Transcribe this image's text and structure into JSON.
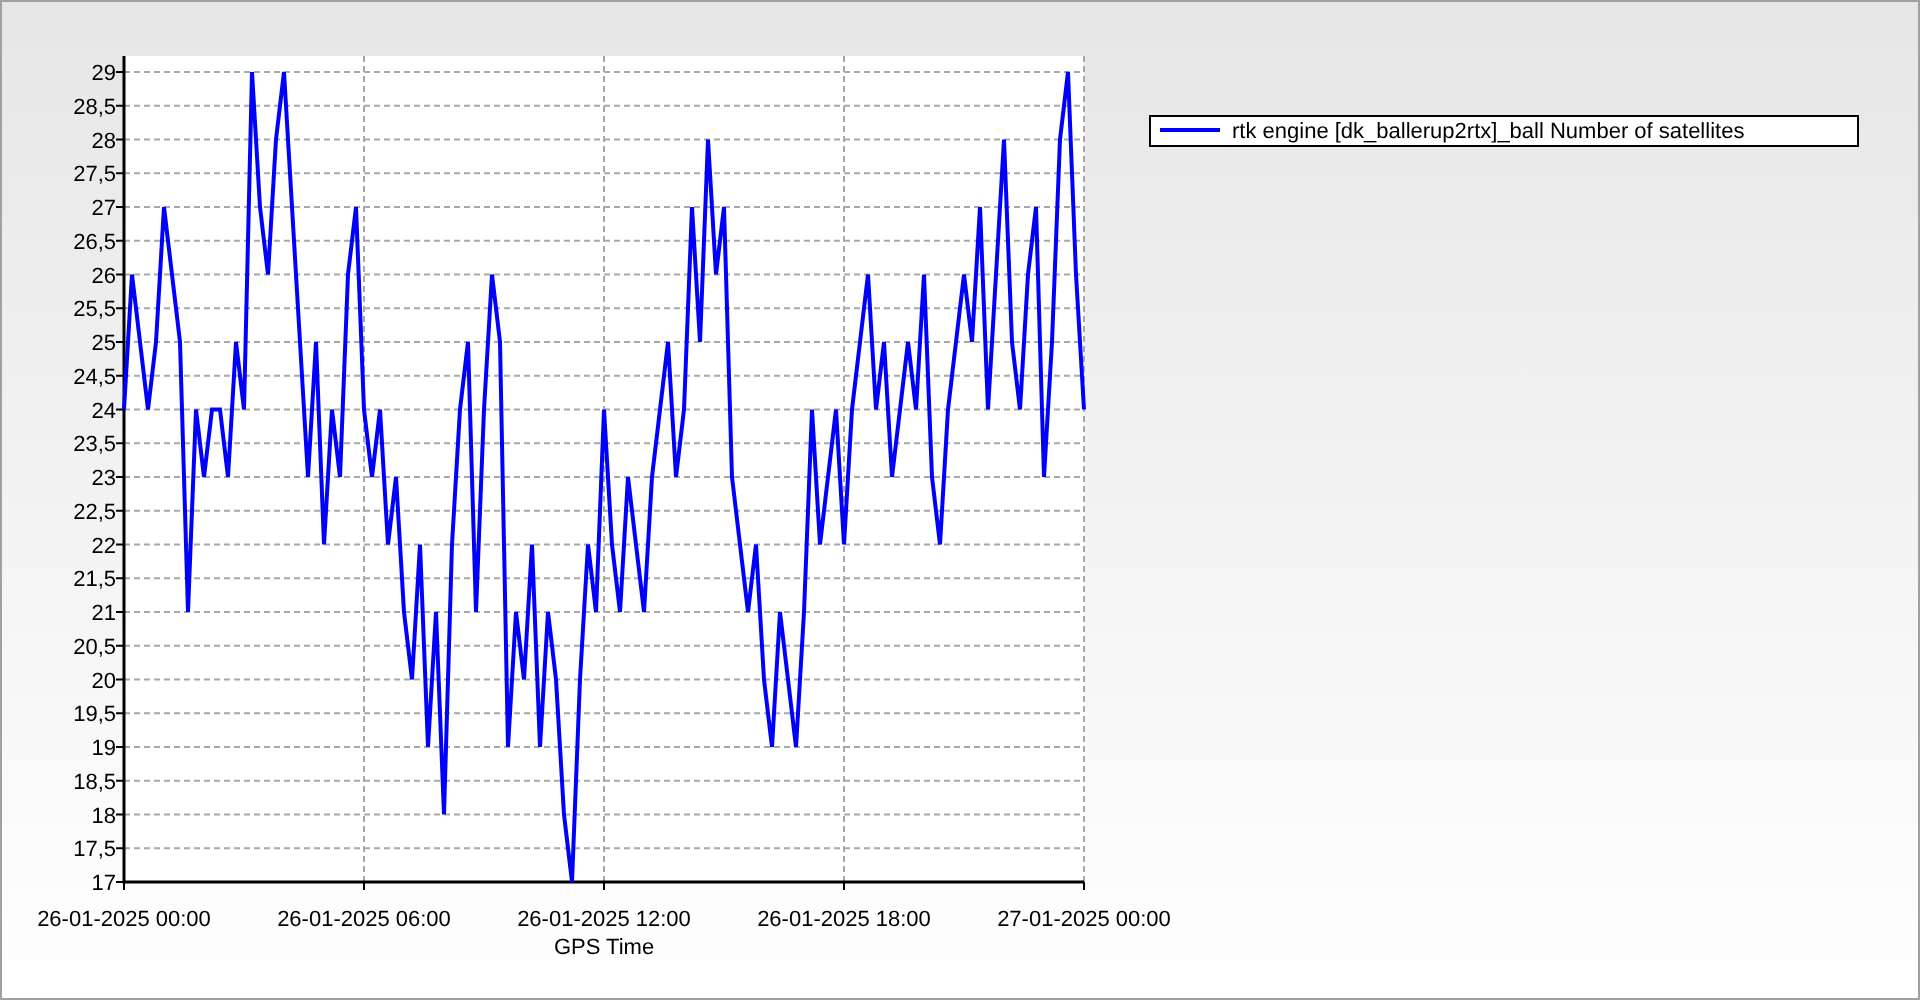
{
  "chart_data": {
    "type": "line",
    "grid": true,
    "xlabel": "GPS Time",
    "ylim": [
      17,
      29
    ],
    "categories": [
      "26-01-2025 00:00",
      null,
      null,
      null,
      null,
      null,
      null,
      null,
      null,
      null,
      null,
      null,
      null,
      null,
      null,
      null,
      null,
      null,
      null,
      null,
      null,
      null,
      null,
      null,
      null,
      null,
      null,
      null,
      null,
      null,
      "26-01-2025 06:00",
      null,
      null,
      null,
      null,
      null,
      null,
      null,
      null,
      null,
      null,
      null,
      null,
      null,
      null,
      null,
      null,
      null,
      null,
      null,
      null,
      null,
      null,
      null,
      null,
      null,
      null,
      null,
      null,
      null,
      "26-01-2025 12:00",
      null,
      null,
      null,
      null,
      null,
      null,
      null,
      null,
      null,
      null,
      null,
      null,
      null,
      null,
      null,
      null,
      null,
      null,
      null,
      null,
      null,
      null,
      null,
      null,
      null,
      null,
      null,
      null,
      null,
      "26-01-2025 18:00",
      null,
      null,
      null,
      null,
      null,
      null,
      null,
      null,
      null,
      null,
      null,
      null,
      null,
      null,
      null,
      null,
      null,
      null,
      null,
      null,
      null,
      null,
      null,
      null,
      null,
      null,
      null,
      null,
      null,
      "27-01-2025 00:00"
    ],
    "yticks": [
      {
        "value": 17,
        "label": "17"
      },
      {
        "value": 17.5,
        "label": "17,5"
      },
      {
        "value": 18,
        "label": "18"
      },
      {
        "value": 18.5,
        "label": "18,5"
      },
      {
        "value": 19,
        "label": "19"
      },
      {
        "value": 19.5,
        "label": "19,5"
      },
      {
        "value": 20,
        "label": "20"
      },
      {
        "value": 20.5,
        "label": "20,5"
      },
      {
        "value": 21,
        "label": "21"
      },
      {
        "value": 21.5,
        "label": "21,5"
      },
      {
        "value": 22,
        "label": "22"
      },
      {
        "value": 22.5,
        "label": "22,5"
      },
      {
        "value": 23,
        "label": "23"
      },
      {
        "value": 23.5,
        "label": "23,5"
      },
      {
        "value": 24,
        "label": "24"
      },
      {
        "value": 24.5,
        "label": "24,5"
      },
      {
        "value": 25,
        "label": "25"
      },
      {
        "value": 25.5,
        "label": "25,5"
      },
      {
        "value": 26,
        "label": "26"
      },
      {
        "value": 26.5,
        "label": "26,5"
      },
      {
        "value": 27,
        "label": "27"
      },
      {
        "value": 27.5,
        "label": "27,5"
      },
      {
        "value": 28,
        "label": "28"
      },
      {
        "value": 28.5,
        "label": "28,5"
      },
      {
        "value": 29,
        "label": "29"
      }
    ],
    "series": [
      {
        "name": "rtk engine [dk_ballerup2rtx]_ball Number of satellites",
        "color": "#0000ff",
        "values": [
          24,
          26,
          25,
          24,
          25,
          27,
          26,
          25,
          21,
          24,
          23,
          24,
          24,
          23,
          25,
          24,
          29,
          27,
          26,
          28,
          29,
          27,
          25,
          23,
          25,
          22,
          24,
          23,
          26,
          27,
          24,
          23,
          24,
          22,
          23,
          21,
          20,
          22,
          19,
          21,
          18,
          22,
          24,
          25,
          21,
          24,
          26,
          25,
          19,
          21,
          20,
          22,
          19,
          21,
          20,
          18,
          17,
          20,
          22,
          21,
          24,
          22,
          21,
          23,
          22,
          21,
          23,
          24,
          25,
          23,
          24,
          27,
          25,
          28,
          26,
          27,
          23,
          22,
          21,
          22,
          20,
          19,
          21,
          20,
          19,
          21,
          24,
          22,
          23,
          24,
          22,
          24,
          25,
          26,
          24,
          25,
          23,
          24,
          25,
          24,
          26,
          23,
          22,
          24,
          25,
          26,
          25,
          27,
          24,
          26,
          28,
          25,
          24,
          26,
          27,
          23,
          25,
          28,
          29,
          26,
          24
        ]
      }
    ]
  }
}
